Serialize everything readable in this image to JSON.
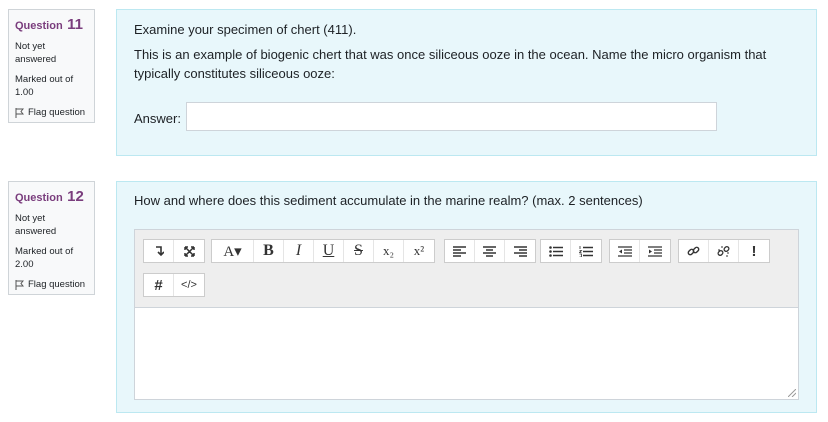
{
  "questions": [
    {
      "label": "Question",
      "number": "11",
      "state": "Not yet answered",
      "grade": "Marked out of 1.00",
      "flag": "Flag question",
      "intro": "Examine your specimen of chert (411).",
      "text": "This is an example of biogenic chert that was once siliceous ooze in the ocean. Name the micro organism that typically constitutes siliceous ooze:",
      "answer_label": "Answer:",
      "answer_value": ""
    },
    {
      "label": "Question",
      "number": "12",
      "state": "Not yet answered",
      "grade": "Marked out of 2.00",
      "flag": "Flag question",
      "text": "How and where does this sediment accumulate in the marine realm? (max. 2 sentences)"
    }
  ],
  "toolbar": {
    "row1": [
      [
        "collapse-icon",
        "expand-icon"
      ],
      [
        "font-color-icon",
        "bold-icon",
        "italic-icon",
        "underline-icon",
        "strikethrough-icon",
        "subscript-icon",
        "superscript-icon"
      ],
      [
        "align-left-icon",
        "align-center-icon",
        "align-right-icon"
      ],
      [
        "unordered-list-icon",
        "ordered-list-icon"
      ],
      [
        "outdent-icon",
        "indent-icon"
      ],
      [
        "link-icon",
        "unlink-icon",
        "accessibility-checker-icon"
      ]
    ],
    "row2": [
      [
        "hashtag-icon",
        "html-source-icon"
      ]
    ],
    "glyphs": {
      "bold": "B",
      "italic": "I",
      "underline": "U",
      "strike": "S",
      "sub": "x₂",
      "sup": "x²",
      "font": "A▾",
      "warn": "!",
      "hash": "#",
      "code": "</>"
    }
  }
}
